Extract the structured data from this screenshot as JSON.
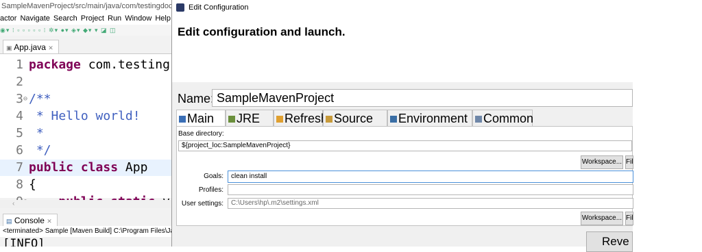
{
  "eclipse": {
    "title": "SampleMavenProject/src/main/java/com/testingdocs/sam",
    "menu": [
      "actor",
      "Navigate",
      "Search",
      "Project",
      "Run",
      "Window",
      "Help"
    ],
    "editor_tab": "App.java",
    "code_lines": [
      {
        "num": "1",
        "gutter": "",
        "tokens": [
          {
            "t": "package",
            "c": "kw"
          },
          {
            "t": " com.testing",
            "c": ""
          }
        ]
      },
      {
        "num": "2",
        "gutter": "",
        "tokens": []
      },
      {
        "num": "3",
        "gutter": "⊖",
        "tokens": [
          {
            "t": "/**",
            "c": "cm"
          }
        ]
      },
      {
        "num": "4",
        "gutter": "",
        "tokens": [
          {
            "t": " * Hello world!",
            "c": "cm"
          }
        ]
      },
      {
        "num": "5",
        "gutter": "",
        "tokens": [
          {
            "t": " *",
            "c": "cm"
          }
        ]
      },
      {
        "num": "6",
        "gutter": "",
        "tokens": [
          {
            "t": " */",
            "c": "cm"
          }
        ]
      },
      {
        "num": "7",
        "gutter": "",
        "tokens": [
          {
            "t": "public",
            "c": "kw"
          },
          {
            "t": " ",
            "c": ""
          },
          {
            "t": "class",
            "c": "kw"
          },
          {
            "t": " App",
            "c": ""
          }
        ],
        "highlight": true
      },
      {
        "num": "8",
        "gutter": "",
        "tokens": [
          {
            "t": "{",
            "c": ""
          }
        ]
      },
      {
        "num": "9",
        "gutter": "⊖",
        "tokens": [
          {
            "t": "    ",
            "c": ""
          },
          {
            "t": "public",
            "c": "kw"
          },
          {
            "t": " ",
            "c": ""
          },
          {
            "t": "static",
            "c": "kw"
          },
          {
            "t": " v",
            "c": ""
          }
        ]
      }
    ],
    "scroll_left_icon": "‹",
    "console_tab": "Console",
    "console_desc": "<terminated> Sample [Maven Build] C:\\Program Files\\Ja",
    "console_output": "[INFO]"
  },
  "dialog": {
    "title": "Edit Configuration",
    "heading": "Edit configuration and launch.",
    "name_label": "Name:",
    "name_value": "SampleMavenProject",
    "tabs": [
      {
        "label": "Main",
        "icon": "main-tab-icon",
        "color": "#3b6fb6"
      },
      {
        "label": "JRE",
        "icon": "jre-tab-icon",
        "color": "#6a8f3c"
      },
      {
        "label": "Refresh",
        "icon": "refresh-tab-icon",
        "color": "#e0a030"
      },
      {
        "label": "Source",
        "icon": "source-tab-icon",
        "color": "#c89b3c"
      },
      {
        "label": "Environment",
        "icon": "environment-tab-icon",
        "color": "#3a6ea5"
      },
      {
        "label": "Common",
        "icon": "common-tab-icon",
        "color": "#6f87a8"
      }
    ],
    "base_directory_label": "Base directory:",
    "base_directory_value": "${project_loc:SampleMavenProject}",
    "workspace_button": "Workspace...",
    "file_button": "File",
    "goals_label": "Goals:",
    "goals_value": "clean install",
    "profiles_label": "Profiles:",
    "profiles_value": "",
    "user_settings_label": "User settings:",
    "user_settings_value": "C:\\Users\\hp\\.m2\\settings.xml",
    "revert_button": "Reve"
  }
}
